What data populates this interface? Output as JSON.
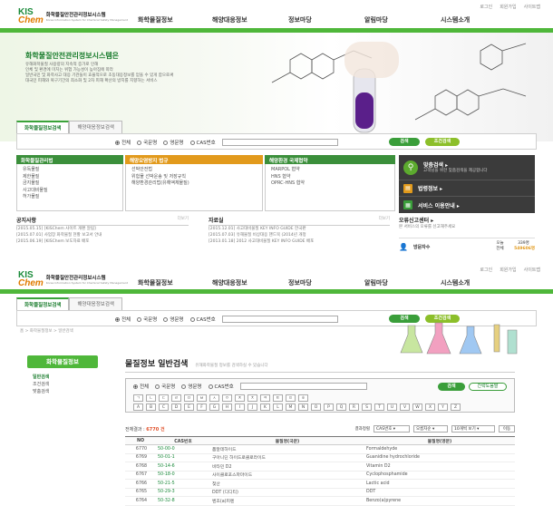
{
  "top": {
    "utility_links": [
      "로그인",
      "회원가입",
      "사이트맵"
    ],
    "logo": {
      "mark_top": "KIS",
      "mark_bottom": "Chem",
      "name": "화학물질안전관리정보시스템",
      "tagline": "Korea Information System for Chemical Safety Management"
    },
    "gnb": [
      "화학물질정보",
      "해양대응정보",
      "정보마당",
      "알림마당",
      "시스템소개"
    ],
    "hero": {
      "title": "화학물질안전관리정보시스템은",
      "desc": [
        "유해화학물질 사용량의 지속적 증가로 인해",
        "인체 및 환경에 미치는 위험 가능성이 높아짐에 따라",
        "일반국민 및 화학사고 대응 기관들이 효율적으로 초동대응정보를 얻을 수 있게 함으로써",
        "대국민 피해와 복구기간의 최소화 및 2차 피해 확산의 방지를 지향하는 서비스"
      ]
    },
    "search": {
      "tabs": [
        "화학물질정보검색",
        "해양대응정보검색"
      ],
      "radios": [
        "전체",
        "국문명",
        "영문명",
        "CAS번호"
      ],
      "search_btn": "검색",
      "adv_btn": "조건검색"
    },
    "panels": [
      {
        "title": "화학물질관리법",
        "color": "#3b8f3b",
        "items": [
          "유독물질",
          "제한물질",
          "금지물질",
          "사고대비물질",
          "허가물질"
        ]
      },
      {
        "title": "해양오염방지 법규",
        "color": "#e29a1c",
        "items": [
          "선박안전법",
          "위험물 선박운송 및 저장규칙",
          "해양환경관리법(유해액체물질)"
        ]
      },
      {
        "title": "해양환경 국제협약",
        "color": "#3b8f3b",
        "items": [
          "MARPOL 협약",
          "HNS 협약",
          "OPRC-HNS 협약"
        ]
      }
    ],
    "dark": {
      "rows": [
        {
          "icon": "search-icon",
          "title": "맞춤검색 ▸",
          "sub": "고객님을 위한 맞춤검색을 제공합니다"
        },
        {
          "icon": "law-icon",
          "title": "법령정보 ▸",
          "sub": ""
        },
        {
          "icon": "service-icon",
          "title": "서비스 이용안내 ▸",
          "sub": ""
        }
      ]
    },
    "notice": {
      "title": "공지사항",
      "more": "더보기",
      "items": [
        "[2015.05.15] [KISChem 사이트 개편 알림]",
        "[2015.07.01] 사업장 화학물질 현황 보고서 안내",
        "[2015.06.19] [KISChem 보도자료 배포"
      ]
    },
    "data": {
      "title": "자료실",
      "more": "더보기",
      "items": [
        "[2015.12.01] 사고대비물질 KEY INFO GUIDE 한국판",
        "[2015.07.03] 유해물질 비상대응 핸드북 (2014년 개정",
        "[2013.01.18] 2012 사고대비물질 KEY INFO GUIDE 배포"
      ]
    },
    "report": {
      "title": "오류신고센터 ▸",
      "sub": "본 서비스의 오류를 신고해주세요"
    },
    "visitor": {
      "label": "방문자수",
      "today_label": "오늘",
      "today": "339명",
      "total_label": "전체",
      "total": "549606명"
    }
  },
  "bottom": {
    "utility_links": [
      "로그인",
      "회원가입",
      "사이트맵"
    ],
    "logo": {
      "mark_top": "KIS",
      "mark_bottom": "Chem",
      "name": "화학물질안전관리정보시스템",
      "tagline": "Korea Information System for Chemical Safety Management"
    },
    "gnb": [
      "화학물질정보",
      "해양대응정보",
      "정보마당",
      "알림마당",
      "시스템소개"
    ],
    "search": {
      "tabs": [
        "화학물질정보검색",
        "해양대응정보검색"
      ],
      "radios": [
        "전체",
        "국문명",
        "영문명",
        "CAS번호"
      ],
      "search_btn": "검색",
      "adv_btn": "조건검색"
    },
    "breadcrumb": "홈 > 화학물질정보 > 일반검색",
    "leftnav": {
      "title": "화학물질정보",
      "items": [
        "일반검색",
        "조건검색",
        "맞춤검색"
      ]
    },
    "page_title": "물질정보 일반검색",
    "page_desc": "유해화학물질 정보를 검색하실 수 있습니다",
    "search2": {
      "radios": [
        "전체",
        "국문명",
        "영문명",
        "CAS번호"
      ],
      "search_btn": "검색",
      "adv_btn": "간략도움말"
    },
    "korean_initials": [
      "ㄱ",
      "ㄴ",
      "ㄷ",
      "ㄹ",
      "ㅁ",
      "ㅂ",
      "ㅅ",
      "ㅇ",
      "ㅈ",
      "ㅊ",
      "ㅋ",
      "ㅌ",
      "ㅍ",
      "ㅎ"
    ],
    "alpha_initials": [
      "A",
      "B",
      "C",
      "D",
      "E",
      "F",
      "G",
      "H",
      "I",
      "J",
      "K",
      "L",
      "M",
      "N",
      "O",
      "P",
      "Q",
      "R",
      "S",
      "T",
      "U",
      "V",
      "W",
      "X",
      "Y",
      "Z"
    ],
    "results": {
      "label": "전체결과 :",
      "count": "6770 건",
      "sort_label": "결과정렬",
      "sort_field": "CAS번호",
      "order": "오름차순",
      "per_page": "10개씩 보기",
      "go_btn": "이동"
    },
    "table": {
      "headers": [
        "NO",
        "CAS번호",
        "물질명(국문)",
        "물질명(영문)"
      ],
      "rows": [
        {
          "no": "6770",
          "cas": "50-00-0",
          "kor": "폼알데하이드",
          "eng": "Formaldehyde"
        },
        {
          "no": "6769",
          "cas": "50-01-1",
          "kor": "구아니딘 하이드로클로라이드",
          "eng": "Guanidine hydrochloride"
        },
        {
          "no": "6768",
          "cas": "50-14-6",
          "kor": "비타민 D2",
          "eng": "Vitamin D2"
        },
        {
          "no": "6767",
          "cas": "50-18-0",
          "kor": "사이클로포스파마이드",
          "eng": "Cyclophosphamide"
        },
        {
          "no": "6766",
          "cas": "50-21-5",
          "kor": "젖산",
          "eng": "Lactic acid"
        },
        {
          "no": "6765",
          "cas": "50-29-3",
          "kor": "DDT (디디티)",
          "eng": "DDT"
        },
        {
          "no": "6764",
          "cas": "50-32-8",
          "kor": "벤조(a)피렌",
          "eng": "Benzo(a)pyrene"
        }
      ]
    }
  },
  "colors": {
    "brand_green": "#4fb73a",
    "accent_orange": "#e29a1c",
    "count_red": "#e0502a"
  }
}
